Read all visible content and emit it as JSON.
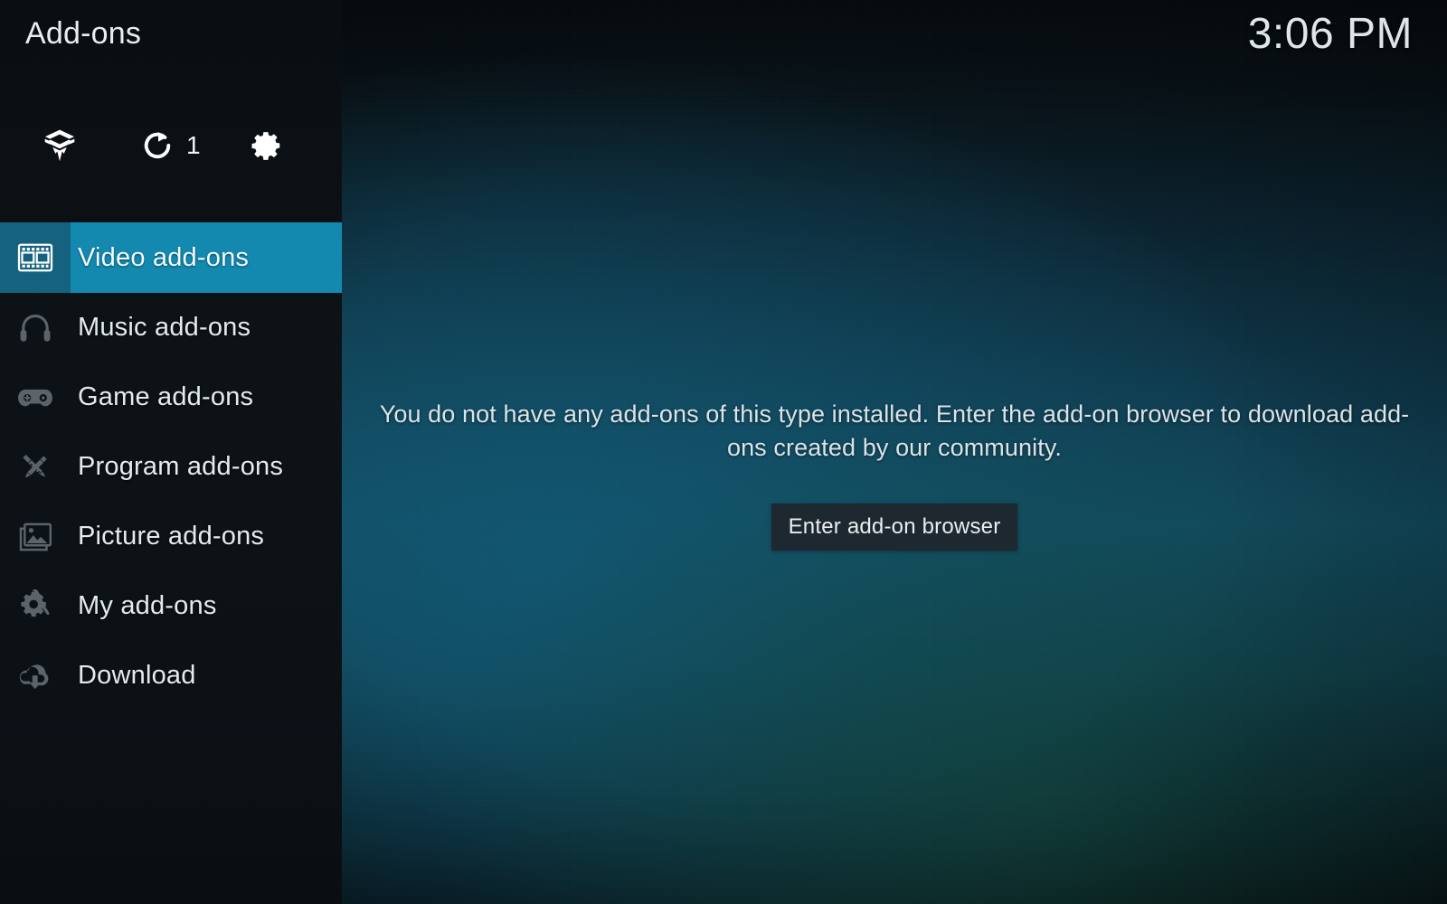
{
  "window": {
    "title": "Add-ons",
    "clock": "3:06 PM"
  },
  "colors": {
    "accent_selected": "#1389b0",
    "accent_selected_icon_cell": "#14627e",
    "sidebar_bg": "#0d1217",
    "button_bg": "#1d2830",
    "text_primary": "#e4ebef"
  },
  "toolbar": {
    "items": [
      {
        "name": "addon-browser",
        "icon": "open-box-icon",
        "label": ""
      },
      {
        "name": "check-updates",
        "icon": "refresh-icon",
        "label": "",
        "badge": "1"
      },
      {
        "name": "addon-settings",
        "icon": "gear-icon",
        "label": ""
      }
    ],
    "update_count": "1"
  },
  "sidebar": {
    "items": [
      {
        "label": "Video add-ons",
        "icon": "film-strip-icon",
        "selected": true
      },
      {
        "label": "Music add-ons",
        "icon": "headphones-icon",
        "selected": false
      },
      {
        "label": "Game add-ons",
        "icon": "gamepad-icon",
        "selected": false
      },
      {
        "label": "Program add-ons",
        "icon": "pencil-ruler-icon",
        "selected": false
      },
      {
        "label": "Picture add-ons",
        "icon": "picture-icon",
        "selected": false
      },
      {
        "label": "My add-ons",
        "icon": "gear-screwdriver-icon",
        "selected": false
      },
      {
        "label": "Download",
        "icon": "cloud-download-icon",
        "selected": false
      }
    ]
  },
  "main": {
    "empty_message": "You do not have any add-ons of this type installed. Enter the add-on browser to download add-ons created by our community.",
    "browser_button_label": "Enter add-on browser"
  }
}
